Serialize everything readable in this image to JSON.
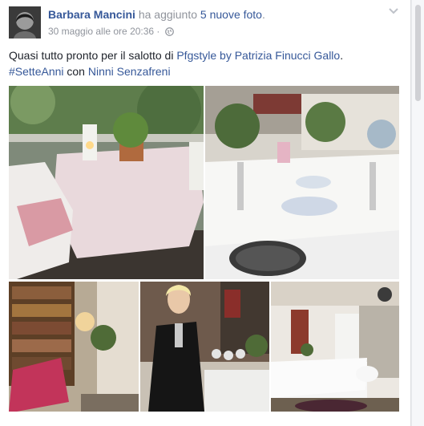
{
  "post": {
    "author": "Barbara Mancini",
    "action": "ha aggiunto",
    "photos_link": "5 nuove foto",
    "period": ".",
    "timestamp": "30 maggio alle ore 20:36",
    "separator": " · ",
    "privacy_icon": "globe-icon",
    "menu_icon": "chevron-down-icon",
    "text": {
      "part1": "Quasi tutto pronto per il salotto di ",
      "page_link": "Pfgstyle by Patrizia Finucci Gallo",
      "part2": ".",
      "hashtag": "#SetteAnni",
      "with": " con ",
      "tagged": "Ninni Senzafreni"
    }
  },
  "photos": [
    {
      "subject": "balcony table with plant and lantern"
    },
    {
      "subject": "table set with glasses and cake stands"
    },
    {
      "subject": "bookshelf and red armchair"
    },
    {
      "subject": "woman in black dress by table"
    },
    {
      "subject": "room with white table and chairs"
    }
  ],
  "colors": {
    "link": "#365899",
    "meta": "#90949c",
    "text": "#1d2129"
  }
}
